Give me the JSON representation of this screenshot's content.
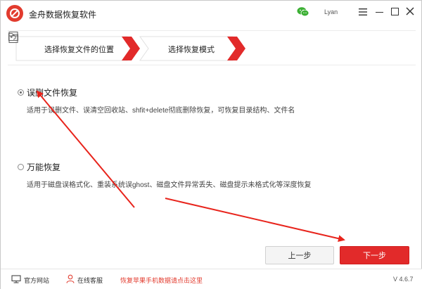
{
  "window": {
    "title": "金舟数据恢复软件",
    "user_name": "Lyan"
  },
  "steps": [
    {
      "label": "选择恢复文件的位置",
      "icon": "folder-icon"
    },
    {
      "label": "选择恢复模式",
      "icon": "restore-icon"
    }
  ],
  "options": [
    {
      "title": "误删文件恢复",
      "description": "适用于误删文件、误清空回收站、shfit+delete彻底删除恢复，可恢复目录结构、文件名",
      "selected": true
    },
    {
      "title": "万能恢复",
      "description": "适用于磁盘误格式化、重装系统误ghost、磁盘文件异常丢失、磁盘提示未格式化等深度恢复",
      "selected": false
    }
  ],
  "buttons": {
    "prev": "上一步",
    "next": "下一步"
  },
  "footer": {
    "official_site": "官方网站",
    "online_service": "在线客服",
    "promo": "恢复苹果手机数据请点击这里",
    "version": "V 4.6.7"
  },
  "colors": {
    "brand_red": "#e23b2e",
    "next_button": "#e22a2a",
    "arrow": "#e8241c",
    "wechat_green": "#3cb034"
  }
}
